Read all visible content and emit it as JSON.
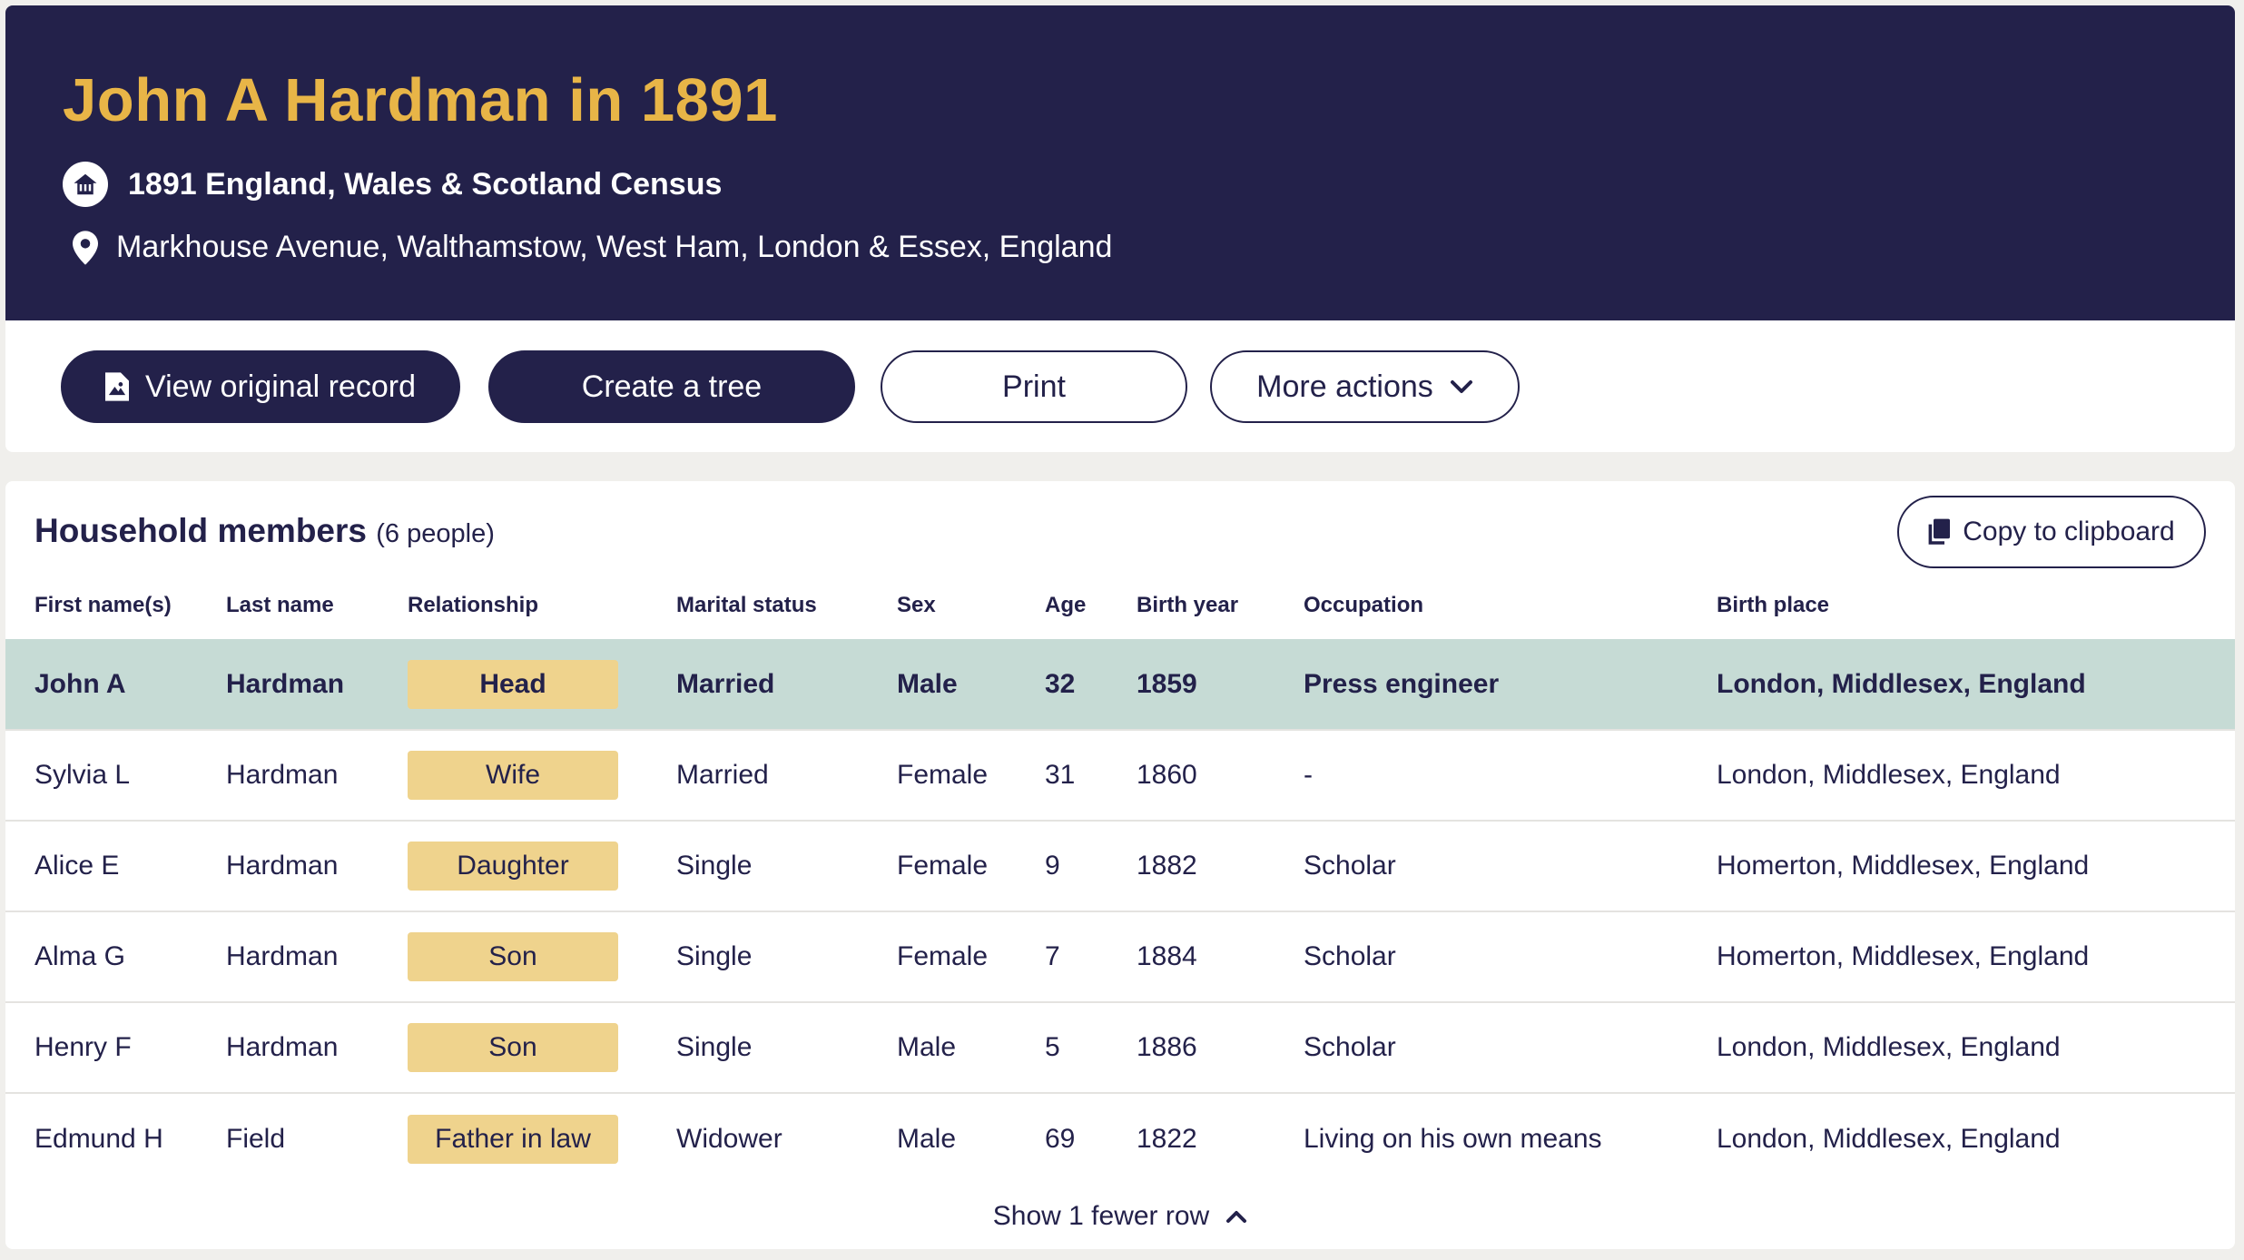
{
  "header": {
    "title": "John A Hardman in 1891",
    "census": "1891 England, Wales & Scotland Census",
    "census_icon": "house-icon",
    "address": "Markhouse Avenue, Walthamstow, West Ham, London & Essex, England",
    "address_icon": "location-pin-icon",
    "title_color": "#e8b547",
    "background_color": "#23214a"
  },
  "actions": {
    "view_original": "View original record",
    "view_original_icon": "document-image-icon",
    "create_tree": "Create a tree",
    "print": "Print",
    "more_actions": "More actions",
    "more_actions_icon": "chevron-down-icon"
  },
  "household": {
    "title": "Household members",
    "count": "(6 people)",
    "copy_label": "Copy to clipboard",
    "copy_icon": "copy-icon",
    "columns": [
      "First name(s)",
      "Last name",
      "Relationship",
      "Marital status",
      "Sex",
      "Age",
      "Birth year",
      "Occupation",
      "Birth place"
    ],
    "rows": [
      {
        "first": "John A",
        "last": "Hardman",
        "relationship": "Head",
        "marital": "Married",
        "sex": "Male",
        "age": "32",
        "birth_year": "1859",
        "occupation": "Press engineer",
        "birth_place": "London, Middlesex, England"
      },
      {
        "first": "Sylvia L",
        "last": "Hardman",
        "relationship": "Wife",
        "marital": "Married",
        "sex": "Female",
        "age": "31",
        "birth_year": "1860",
        "occupation": "-",
        "birth_place": "London, Middlesex, England"
      },
      {
        "first": "Alice E",
        "last": "Hardman",
        "relationship": "Daughter",
        "marital": "Single",
        "sex": "Female",
        "age": "9",
        "birth_year": "1882",
        "occupation": "Scholar",
        "birth_place": "Homerton, Middlesex, England"
      },
      {
        "first": "Alma G",
        "last": "Hardman",
        "relationship": "Son",
        "marital": "Single",
        "sex": "Female",
        "age": "7",
        "birth_year": "1884",
        "occupation": "Scholar",
        "birth_place": "Homerton, Middlesex, England"
      },
      {
        "first": "Henry F",
        "last": "Hardman",
        "relationship": "Son",
        "marital": "Single",
        "sex": "Male",
        "age": "5",
        "birth_year": "1886",
        "occupation": "Scholar",
        "birth_place": "London, Middlesex, England"
      },
      {
        "first": "Edmund H",
        "last": "Field",
        "relationship": "Father in law",
        "marital": "Widower",
        "sex": "Male",
        "age": "69",
        "birth_year": "1822",
        "occupation": "Living on his own means",
        "birth_place": "London, Middlesex, England"
      }
    ],
    "show_fewer": "Show 1 fewer row",
    "show_fewer_icon": "chevron-up-icon",
    "highlight_color": "#c6dbd5",
    "badge_color": "#efd38d"
  }
}
